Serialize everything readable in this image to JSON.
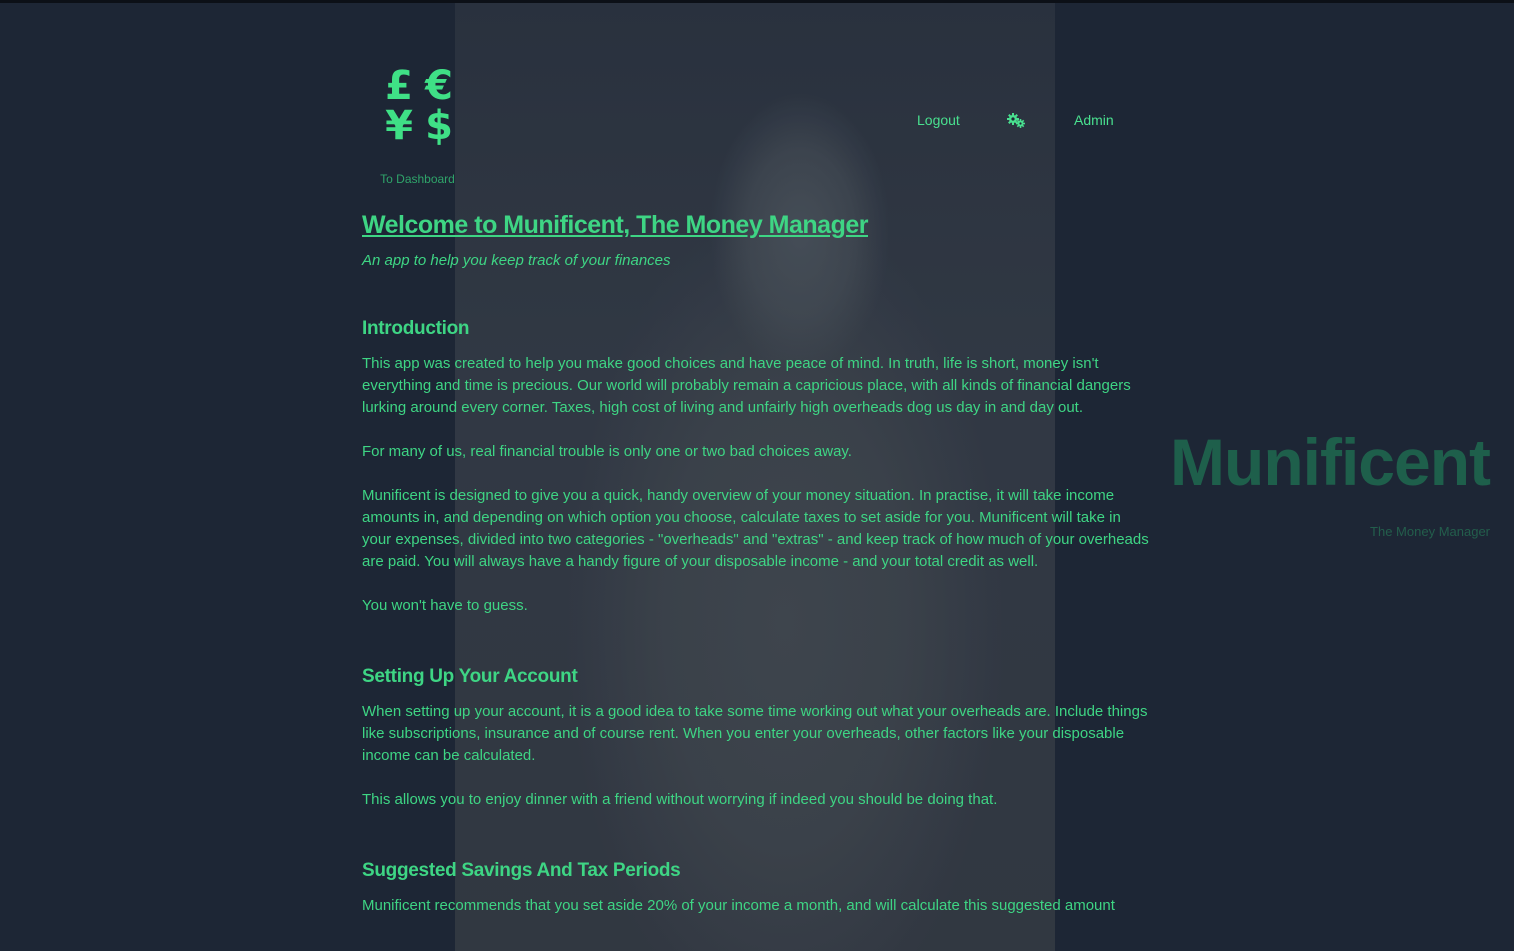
{
  "header": {
    "logo_glyphs": [
      "£",
      "€",
      "¥",
      "$"
    ],
    "to_dashboard": "To Dashboard",
    "nav": {
      "logout": "Logout",
      "settings_icon": "gears-icon",
      "admin": "Admin"
    }
  },
  "side_brand": {
    "title": "Munificent",
    "subtitle": "The Money Manager"
  },
  "main": {
    "title": "Welcome to Munificent, The Money Manager",
    "tagline": "An app to help you keep track of your finances",
    "sections": [
      {
        "heading": "Introduction",
        "paragraphs": [
          "This app was created to help you make good choices and have peace of mind. In truth, life is short, money isn't everything and time is precious. Our world will probably remain a capricious place, with all kinds of financial dangers lurking around every corner. Taxes, high cost of living and unfairly high overheads dog us day in and day out.",
          "For many of us, real financial trouble is only one or two bad choices away.",
          "Munificent is designed to give you a quick, handy overview of your money situation. In practise, it will take income amounts in, and depending on which option you choose, calculate taxes to set aside for you. Munificent will take in your expenses, divided into two categories - \"overheads\" and \"extras\" - and keep track of how much of your overheads are paid. You will always have a handy figure of your disposable income - and your total credit as well.",
          "You won't have to guess."
        ]
      },
      {
        "heading": "Setting Up Your Account",
        "paragraphs": [
          "When setting up your account, it is a good idea to take some time working out what your overheads are. Include things like subscriptions, insurance and of course rent. When you enter your overheads, other factors like your disposable income can be calculated.",
          "This allows you to enjoy dinner with a friend without worrying if indeed you should be doing that."
        ]
      },
      {
        "heading": "Suggested Savings And Tax Periods",
        "paragraphs": [
          "Munificent recommends that you set aside 20% of your income a month, and will calculate this suggested amount"
        ]
      }
    ]
  },
  "colors": {
    "background": "#1d2635",
    "accent": "#3ed584",
    "brand_muted": "#1e5f4b"
  }
}
